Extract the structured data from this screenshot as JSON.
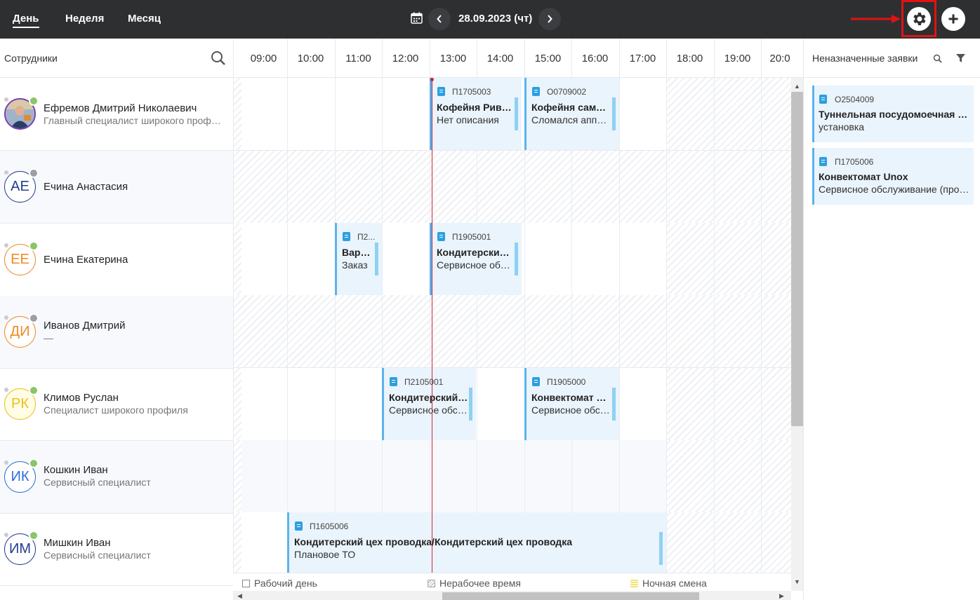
{
  "topbar": {
    "tabs": [
      {
        "label": "День",
        "active": true
      },
      {
        "label": "Неделя",
        "active": false
      },
      {
        "label": "Месяц",
        "active": false
      }
    ],
    "date": "28.09.2023 (чт)",
    "icons": [
      "calendar-icon",
      "chevron-left-icon",
      "chevron-right-icon",
      "gear-icon",
      "plus-icon"
    ],
    "accent_color": "#e21212"
  },
  "header": {
    "employees_label": "Сотрудники",
    "hours": [
      "09:00",
      "10:00",
      "11:00",
      "12:00",
      "13:00",
      "14:00",
      "15:00",
      "16:00",
      "17:00",
      "18:00",
      "19:00",
      "20:0"
    ],
    "unassigned_label": "Неназначенные заявки"
  },
  "employees": [
    {
      "initials": "",
      "name": "Ефремов Дмитрий Николаевич",
      "role": "Главный специалист широкого профиля",
      "status": "online",
      "photo": true
    },
    {
      "initials": "АЕ",
      "name": "Ечина Анастасия",
      "role": "",
      "status": "off",
      "color": "#233d8f"
    },
    {
      "initials": "ЕЕ",
      "name": "Ечина Екатерина",
      "role": "",
      "status": "online",
      "color": "#f08a24"
    },
    {
      "initials": "ДИ",
      "name": "Иванов Дмитрий",
      "role": "—",
      "status": "off",
      "color": "#f08a24"
    },
    {
      "initials": "РК",
      "name": "Климов Руслан",
      "role": "Специалист широкого профиля",
      "status": "online",
      "color": "#e8c21a"
    },
    {
      "initials": "ИК",
      "name": "Кошкин Иван",
      "role": "Сервисный специалист",
      "status": "online",
      "color": "#2b6fd6"
    },
    {
      "initials": "ИМ",
      "name": "Мишкин Иван",
      "role": "Сервисный специалист",
      "status": "online",
      "color": "#233d8f"
    }
  ],
  "tasks": [
    {
      "row": 0,
      "id": "П1705003",
      "title": "Кофейня Ривьера",
      "desc": "Нет описания"
    },
    {
      "row": 0,
      "id": "О0709002",
      "title": "Кофейня самообслуживания",
      "desc": "Сломался аппарат"
    },
    {
      "row": 2,
      "id": "П2...",
      "title": "Варочный",
      "desc": "Заказ"
    },
    {
      "row": 2,
      "id": "П1905001",
      "title": "Кондитерский цех",
      "desc": "Сервисное обслуживание"
    },
    {
      "row": 4,
      "id": "П2105001",
      "title": "Кондитерский цех",
      "desc": "Сервисное обслуживание"
    },
    {
      "row": 4,
      "id": "П1905000",
      "title": "Конвектомат Unox",
      "desc": "Сервисное обслуживание"
    },
    {
      "row": 6,
      "id": "П1605006",
      "title": "Кондитерский цех проводка/Кондитерский цех проводка",
      "desc": "Плановое ТО"
    }
  ],
  "legend": {
    "workday": "Рабочий день",
    "nonworking": "Нерабочее время",
    "night": "Ночная смена"
  },
  "unassigned": [
    {
      "id": "О2504009",
      "title": "Туннельная посудомоечная машина",
      "desc": "установка"
    },
    {
      "id": "П1705006",
      "title": "Конвектомат Unox",
      "desc": "Сервисное обслуживание (профилактика)"
    }
  ]
}
